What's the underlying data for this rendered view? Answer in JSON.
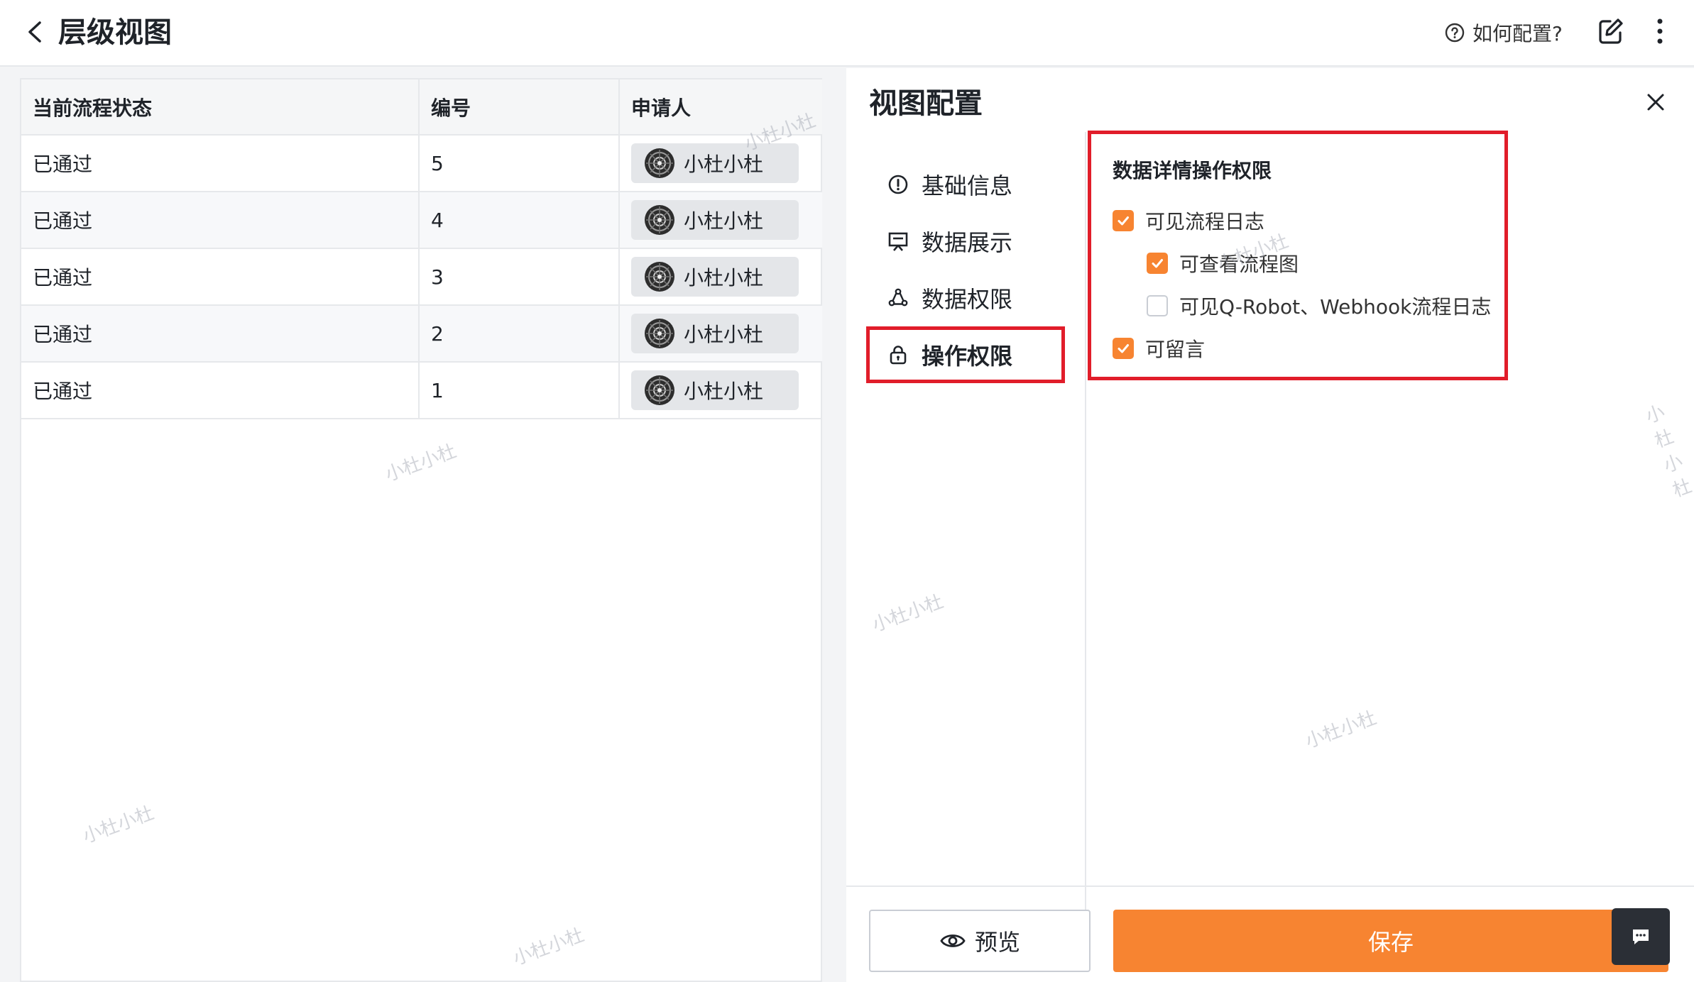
{
  "header": {
    "title": "层级视图",
    "help_label": "如何配置?"
  },
  "table": {
    "columns": [
      "当前流程状态",
      "编号",
      "申请人"
    ],
    "rows": [
      {
        "status": "已通过",
        "number": "5",
        "applicant": "小杜小杜"
      },
      {
        "status": "已通过",
        "number": "4",
        "applicant": "小杜小杜"
      },
      {
        "status": "已通过",
        "number": "3",
        "applicant": "小杜小杜"
      },
      {
        "status": "已通过",
        "number": "2",
        "applicant": "小杜小杜"
      },
      {
        "status": "已通过",
        "number": "1",
        "applicant": "小杜小杜"
      }
    ]
  },
  "config": {
    "title": "视图配置",
    "menu": [
      {
        "label": "基础信息",
        "icon": "info-icon"
      },
      {
        "label": "数据展示",
        "icon": "display-icon"
      },
      {
        "label": "数据权限",
        "icon": "data-permission-icon"
      },
      {
        "label": "操作权限",
        "icon": "lock-icon",
        "active": true
      }
    ],
    "permissions": {
      "title": "数据详情操作权限",
      "options": [
        {
          "label": "可见流程日志",
          "checked": true
        },
        {
          "label": "可查看流程图",
          "checked": true
        },
        {
          "label": "可见Q-Robot、Webhook流程日志",
          "checked": false
        },
        {
          "label": "可留言",
          "checked": true
        }
      ]
    },
    "preview_label": "预览",
    "save_label": "保存"
  },
  "watermark": "小杜小杜",
  "colors": {
    "accent": "#f78431",
    "highlight": "#e11d2a"
  }
}
